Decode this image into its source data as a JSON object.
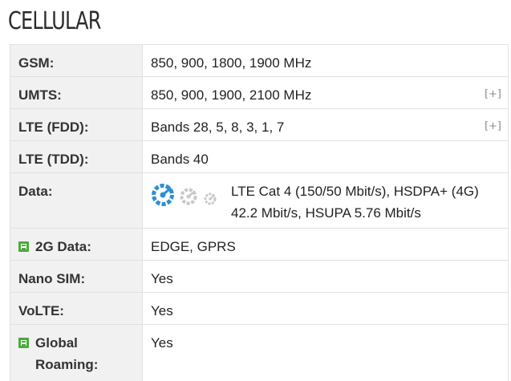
{
  "section": {
    "title": "CELLULAR"
  },
  "colors": {
    "label_background": "#f1f1f1",
    "border": "#e1e1e1",
    "badge_green": "#4caa3c",
    "speed_icon_active": "#2f8fd3",
    "speed_icon_inactive": "#c8c8c8"
  },
  "rows": [
    {
      "label": "GSM:",
      "value": "850, 900, 1800, 1900 MHz"
    },
    {
      "label": "UMTS:",
      "value": "850, 900, 1900, 2100 MHz",
      "toggle": "[+]"
    },
    {
      "label": "LTE (FDD):",
      "value": "Bands 28, 5, 8, 3, 1, 7",
      "toggle": "[+]"
    },
    {
      "label": "LTE (TDD):",
      "value": "Bands 40"
    },
    {
      "label": "Data:",
      "value": "LTE Cat 4 (150/50 Mbit/s), HSDPA+ (4G) 42.2 Mbit/s, HSUPA 5.76 Mbit/s",
      "icons": [
        "speedometer-icon-large",
        "speedometer-icon-medium",
        "speedometer-icon-small"
      ]
    },
    {
      "label": "2G Data:",
      "value": "EDGE, GPRS",
      "icon": "green-badge-icon"
    },
    {
      "label": "Nano SIM:",
      "value": "Yes"
    },
    {
      "label": "VoLTE:",
      "value": "Yes"
    },
    {
      "label": "Global Roaming:",
      "value": "Yes",
      "icon": "green-badge-icon"
    }
  ]
}
